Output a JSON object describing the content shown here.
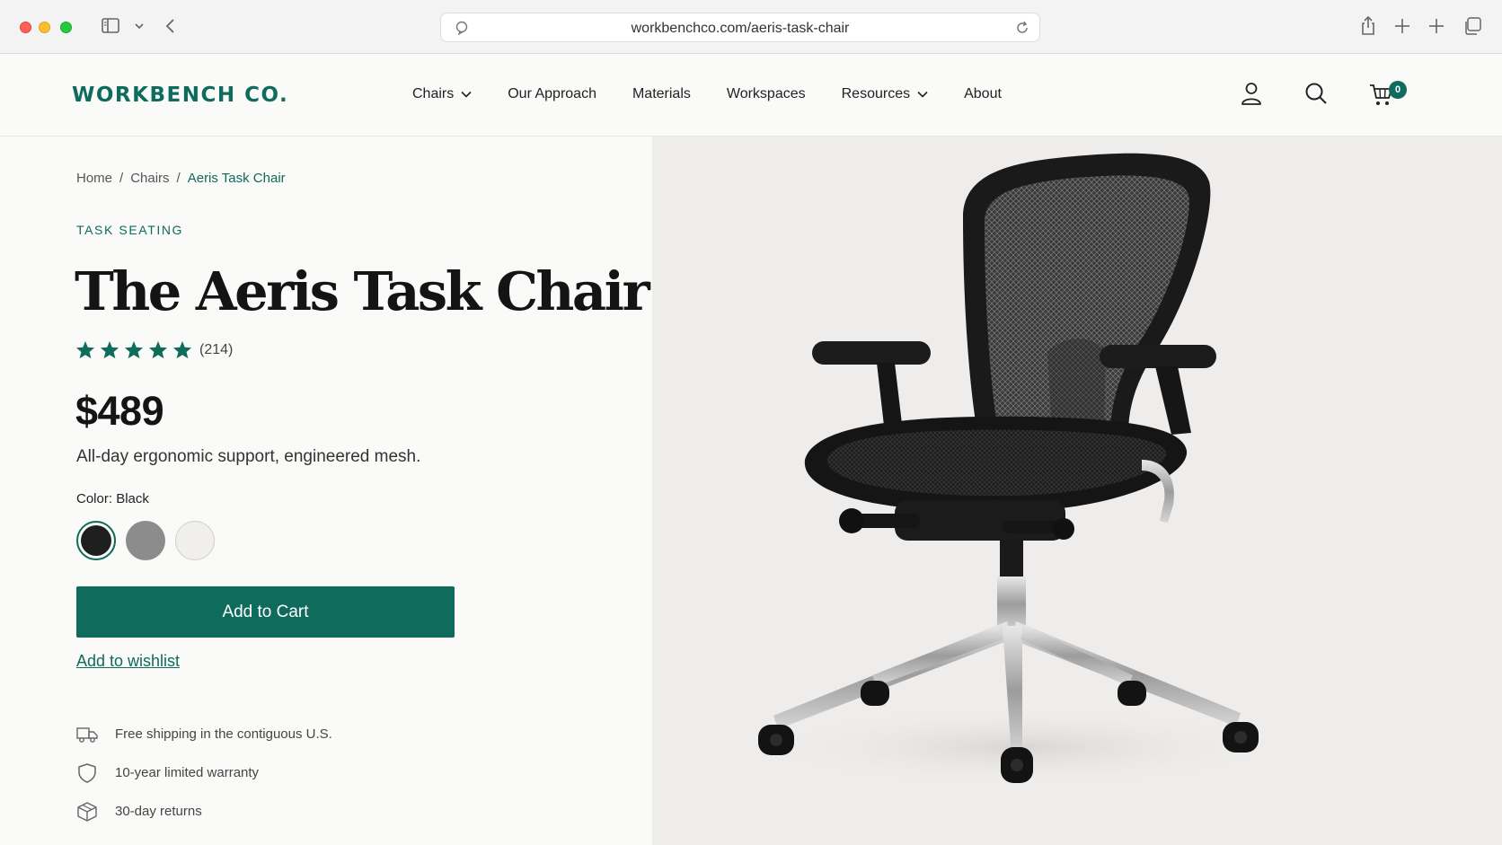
{
  "browser": {
    "url": "workbenchco.com/aeris-task-chair"
  },
  "header": {
    "logo": "WORKBENCH CO.",
    "nav": [
      {
        "label": "Chairs",
        "has_dropdown": true
      },
      {
        "label": "Our Approach",
        "has_dropdown": false
      },
      {
        "label": "Materials",
        "has_dropdown": false
      },
      {
        "label": "Workspaces",
        "has_dropdown": false
      },
      {
        "label": "Resources",
        "has_dropdown": true
      },
      {
        "label": "About",
        "has_dropdown": false
      }
    ],
    "cart_count": "0"
  },
  "breadcrumb": {
    "items": [
      "Home",
      "Chairs",
      "Aeris Task Chair"
    ],
    "separator": "/"
  },
  "product": {
    "eyebrow": "TASK SEATING",
    "title": "The Aeris Task Chair",
    "rating": 5,
    "review_count": "(214)",
    "price": "$489",
    "tagline": "All-day ergonomic support, engineered mesh.",
    "color_label": "Color:",
    "color_value": "Black",
    "swatches": [
      {
        "color": "#1f1f1f",
        "selected": true
      },
      {
        "color": "#8c8c8c",
        "selected": false
      },
      {
        "color": "#f1efeb",
        "selected": false
      }
    ],
    "add_to_cart": "Add to Cart",
    "wishlist": "Add to wishlist",
    "features": [
      {
        "icon": "truck-icon",
        "text": "Free shipping in the contiguous U.S."
      },
      {
        "icon": "shield-icon",
        "text": "10-year limited warranty"
      },
      {
        "icon": "box-icon",
        "text": "30-day returns"
      }
    ]
  },
  "colors": {
    "brand": "#0f6b5b",
    "background": "#fafaf9",
    "image_background": "#efedeb"
  }
}
